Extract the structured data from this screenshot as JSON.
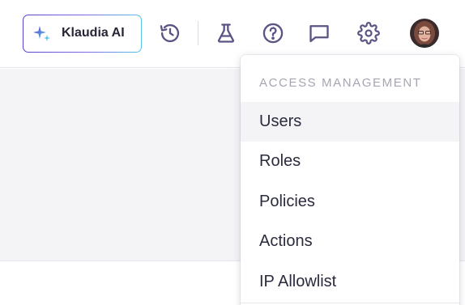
{
  "header": {
    "klaudia_label": "Klaudia AI",
    "icons": [
      "sparkle-icon",
      "history-icon",
      "flask-icon",
      "help-icon",
      "chat-icon",
      "gear-icon"
    ]
  },
  "colors": {
    "icon": "#5a5484",
    "brand_gradient": [
      "#5b3fd1",
      "#57c3e8"
    ],
    "menu_hover": "#f4f4f7"
  },
  "menu": {
    "section_title": "ACCESS MANAGEMENT",
    "items": [
      {
        "label": "Users",
        "hovered": true
      },
      {
        "label": "Roles"
      },
      {
        "label": "Policies"
      },
      {
        "label": "Actions"
      },
      {
        "label": "IP Allowlist"
      }
    ]
  }
}
